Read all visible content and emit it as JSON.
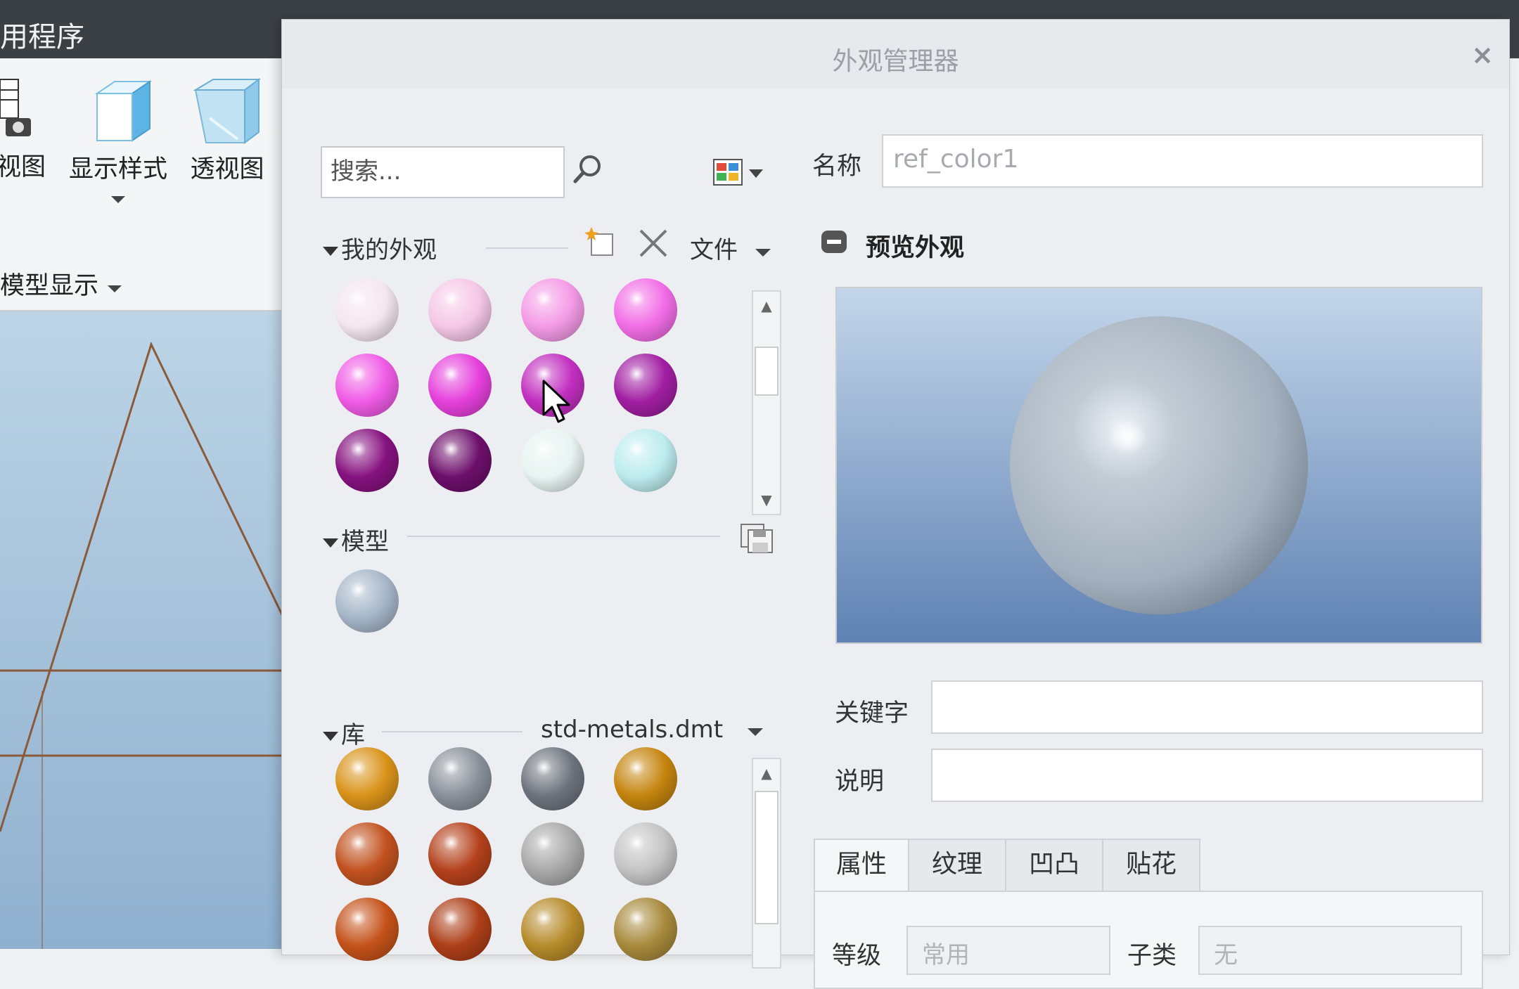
{
  "app": {
    "title_fragment": "用程序",
    "ribbon": {
      "view_button_label": "视图",
      "display_style_label": "显示样式",
      "perspective_label": "透视图",
      "group_label": "模型显示"
    }
  },
  "dialog": {
    "title": "外观管理器",
    "close_label": "×",
    "search": {
      "placeholder": "搜索..."
    },
    "my_appearances": {
      "header": "我的外观",
      "file_menu_label": "文件",
      "swatch_colors": [
        "#f4e6ee",
        "#f5c7e6",
        "#f49ae6",
        "#f26de6",
        "#f05be6",
        "#e640dc",
        "#c22fc0",
        "#a11ea2",
        "#86127f",
        "#6d0f6c",
        "#e8f4f1",
        "#bdecef"
      ]
    },
    "model": {
      "header": "模型",
      "swatch_colors": [
        "#a6b7c9"
      ]
    },
    "library": {
      "header": "库",
      "selected_library": "std-metals.dmt",
      "swatch_colors": [
        "#d9931a",
        "#8a919b",
        "#6e747e",
        "#c5850f",
        "#c2521f",
        "#b4411c",
        "#a9a9a9",
        "#c4c4c4",
        "#c5521a",
        "#ad3f18",
        "#b68b2a",
        "#a88a3c"
      ]
    },
    "properties": {
      "name_label": "名称",
      "name_value": "ref_color1",
      "preview_label": "预览外观",
      "keyword_label": "关键字",
      "keyword_value": "",
      "description_label": "说明",
      "description_value": "",
      "tabs": [
        {
          "label": "属性"
        },
        {
          "label": "纹理"
        },
        {
          "label": "凹凸"
        },
        {
          "label": "贴花"
        }
      ],
      "class_label": "等级",
      "class_value": "常用",
      "subclass_label": "子类",
      "subclass_value": "无"
    }
  }
}
